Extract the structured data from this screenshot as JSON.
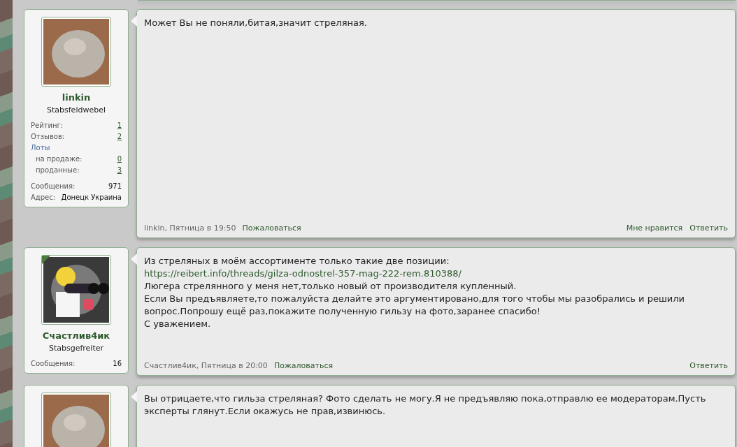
{
  "posts": [
    {
      "user": {
        "name": "linkin",
        "title": "Stabsfeldwebel",
        "kind": "cat",
        "online_marker": false,
        "stats": [
          {
            "kind": "link",
            "label": "Рейтинг:",
            "value": "1"
          },
          {
            "kind": "link",
            "label": "Отзывов:",
            "value": "2"
          },
          {
            "kind": "group",
            "label": "Лоты"
          },
          {
            "kind": "sublink",
            "label": "на продаже:",
            "value": "0"
          },
          {
            "kind": "sublink",
            "label": "проданные:",
            "value": "3"
          },
          {
            "kind": "plain",
            "label": "Сообщения:",
            "value": "971"
          },
          {
            "kind": "plain",
            "label": "Адрес:",
            "value": "Донецк Украина"
          }
        ]
      },
      "message": [
        {
          "kind": "text",
          "text": "Может Вы не поняли,битая,значит стреляная."
        }
      ],
      "footer": {
        "author_time": "linkin, Пятница в 19:50",
        "report": "Пожаловаться",
        "actions": [
          "Мне нравится",
          "Ответить"
        ]
      }
    },
    {
      "user": {
        "name": "Счастлив4ик",
        "title": "Stabsgefreiter",
        "kind": "cartoon",
        "online_marker": true,
        "stats": [
          {
            "kind": "plain",
            "label": "Сообщения:",
            "value": "16"
          }
        ]
      },
      "message": [
        {
          "kind": "text",
          "text": "Из стреляных в моём ассортименте только такие две позиции:"
        },
        {
          "kind": "link",
          "text": "https://reibert.info/threads/gilza-odnostrel-357-mag-222-rem.810388/"
        },
        {
          "kind": "text",
          "text": "Люгера стрелянного у меня нет,только новый от производителя купленный."
        },
        {
          "kind": "text",
          "text": "Если Вы предъявляете,то пожалуйста делайте это аргументировано,для того чтобы мы разобрались и решили вопрос.Попрошу ещё раз,покажите полученную гильзу на фото,заранее спасибо!"
        },
        {
          "kind": "text",
          "text": "С уважением."
        }
      ],
      "footer": {
        "author_time": "Счастлив4ик, Пятница в 20:00",
        "report": "Пожаловаться",
        "actions": [
          "Ответить"
        ]
      }
    },
    {
      "user": {
        "kind": "cat",
        "online_marker": false
      },
      "message": [
        {
          "kind": "text",
          "text": "Вы отрицаете,что гильза стреляная? Фото сделать не могу.Я не предъявляю пока,отправлю ее модераторам.Пусть эксперты глянут.Если окажусь не прав,извинюсь."
        }
      ]
    }
  ]
}
